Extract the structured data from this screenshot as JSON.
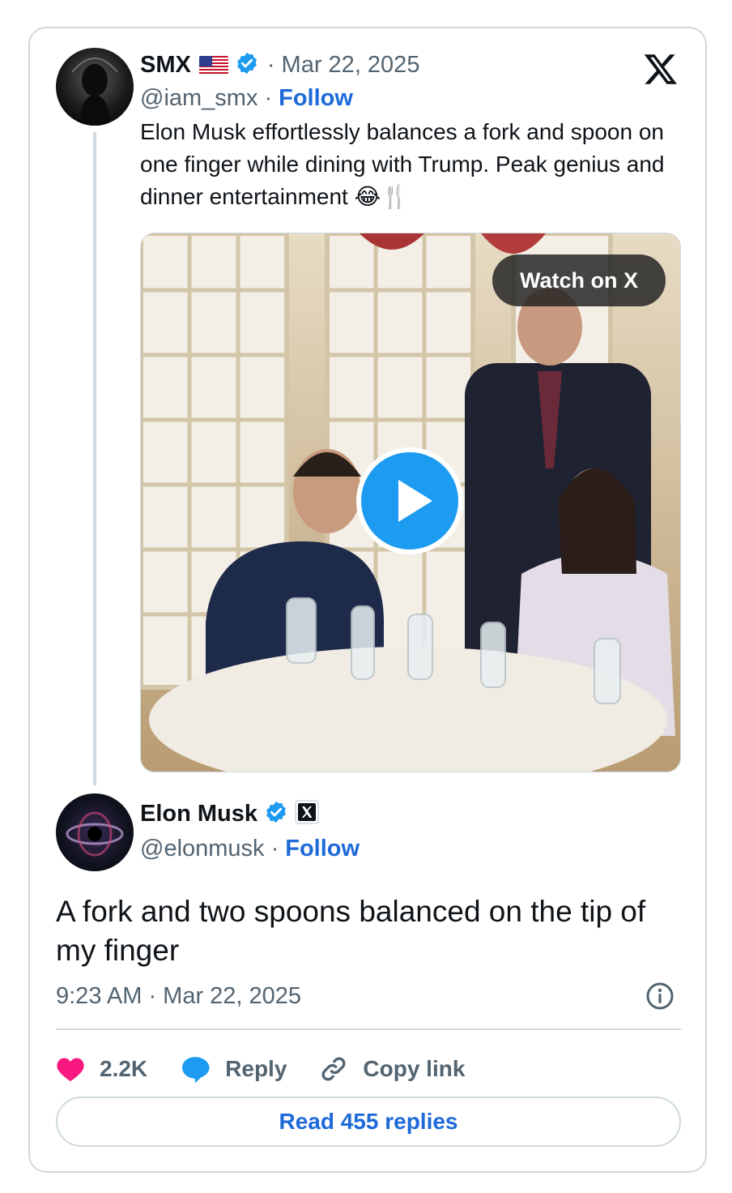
{
  "quoted": {
    "name": "SMX",
    "flag": "🇺🇸",
    "date": "· Mar 22, 2025",
    "handle": "@iam_smx",
    "sep": "·",
    "follow": "Follow",
    "text": "Elon Musk effortlessly balances a fork and spoon on one finger while dining with Trump. Peak genius and dinner entertainment 😂🍴",
    "media": {
      "watch_label": "Watch on X"
    }
  },
  "main": {
    "name": "Elon Musk",
    "handle": "@elonmusk",
    "sep": "·",
    "follow": "Follow",
    "text": "A fork and two spoons balanced on the tip of my finger",
    "timestamp": "9:23 AM · Mar 22, 2025"
  },
  "actions": {
    "likes": "2.2K",
    "reply": "Reply",
    "copy_link": "Copy link"
  },
  "read_replies": "Read 455 replies",
  "colors": {
    "accent": "#1d9bf0",
    "link": "#1d6ad8",
    "like": "#f91880",
    "muted": "#536471"
  }
}
